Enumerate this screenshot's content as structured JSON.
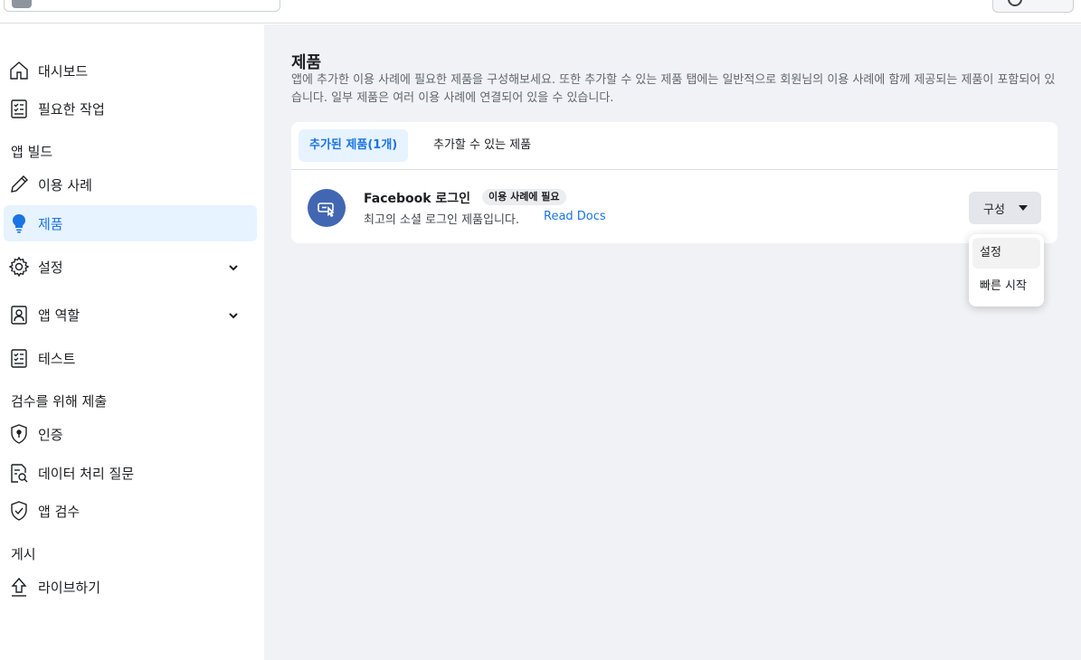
{
  "sidebar": {
    "items": [
      {
        "label": "대시보드",
        "icon": "home-icon"
      },
      {
        "label": "필요한 작업",
        "icon": "checklist-icon"
      },
      {
        "label": "이용 사례",
        "icon": "pencil-icon"
      },
      {
        "label": "제품",
        "icon": "lightbulb-icon"
      },
      {
        "label": "설정",
        "icon": "gear-icon"
      },
      {
        "label": "앱 역할",
        "icon": "id-badge-icon"
      },
      {
        "label": "테스트",
        "icon": "checklist-icon"
      },
      {
        "label": "인증",
        "icon": "shield-lock-icon"
      },
      {
        "label": "데이터 처리 질문",
        "icon": "document-search-icon"
      },
      {
        "label": "앱 검수",
        "icon": "shield-check-icon"
      },
      {
        "label": "라이브하기",
        "icon": "upload-icon"
      }
    ],
    "sections": [
      "앱 빌드",
      "검수를 위해 제출",
      "게시"
    ]
  },
  "main": {
    "title": "제품",
    "description": "앱에 추가한 이용 사례에 필요한 제품을 구성해보세요. 또한 추가할 수 있는 제품 탭에는 일반적으로 회원님의 이용 사례에 함께 제공되는 제품이 포함되어 있습니다. 일부 제품은 여러 이용 사례에 연결되어 있을 수 있습니다.",
    "tabs": [
      {
        "label": "추가된 제품(1개)"
      },
      {
        "label": "추가할 수 있는 제품"
      }
    ],
    "product": {
      "name": "Facebook 로그인",
      "badge": "이용 사례에 필요",
      "description": "최고의 소셜 로그인 제품입니다.",
      "link_label": "Read Docs",
      "config_label": "구성"
    },
    "menu": [
      {
        "label": "설정"
      },
      {
        "label": "빠른 시작"
      }
    ]
  },
  "colors": {
    "accent": "#1b74e4",
    "active_bg": "#e7f3ff",
    "product_icon_bg": "#4267b2",
    "main_bg": "#f0f2f5"
  }
}
